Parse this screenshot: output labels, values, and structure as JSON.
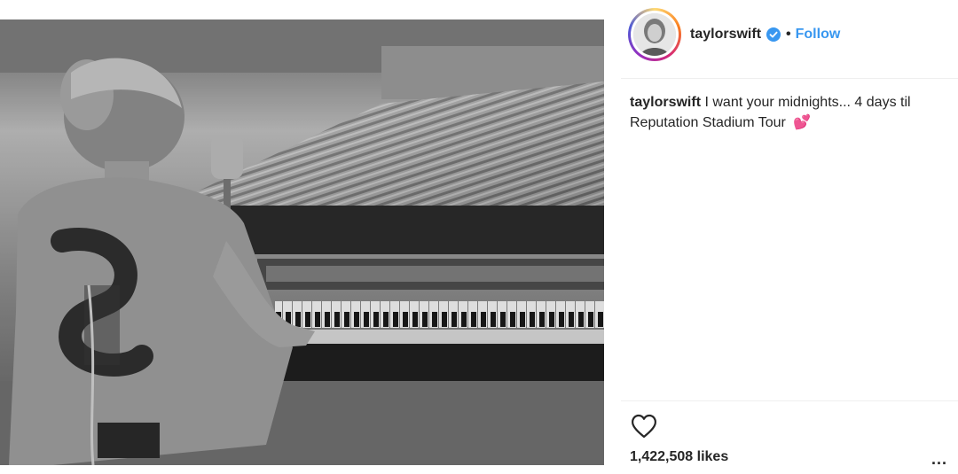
{
  "post": {
    "username": "taylorswift",
    "dot": "•",
    "follow_label": "Follow",
    "caption_user": "taylorswift",
    "caption_text": "I want your midnights... 4 days til Reputation Stadium Tour",
    "caption_emoji": "💕",
    "likes": "1,422,508 likes",
    "more": "..."
  },
  "icons": {
    "verified": "verified-badge-icon",
    "like": "heart-outline-icon",
    "more": "more-options-icon"
  },
  "colors": {
    "follow": "#3897f0",
    "verified": "#3897f0",
    "text": "#262626"
  }
}
